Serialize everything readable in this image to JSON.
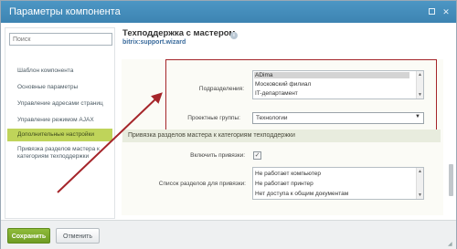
{
  "window": {
    "title": "Параметры компонента"
  },
  "sidebar": {
    "search_placeholder": "Поиск",
    "items": [
      {
        "label": "Шаблон компонента"
      },
      {
        "label": "Основные параметры"
      },
      {
        "label": "Управление адресами страниц"
      },
      {
        "label": "Управление режимом AJAX"
      },
      {
        "label": "Дополнительные настройки",
        "active": true
      },
      {
        "label_line1": "Привязка разделов мастера к",
        "label_line2": "категориям техподдержки"
      }
    ]
  },
  "component": {
    "title": "Техподдержка с мастером",
    "code": "bitrix:support.wizard"
  },
  "fields": {
    "departments": {
      "label": "Подразделения:",
      "options": [
        "ADima",
        "Московский филиал",
        "IT-департамент"
      ],
      "selected": "ADima"
    },
    "project_groups": {
      "label": "Проектные группы:",
      "value": "Технологии"
    },
    "section_title": "Привязка разделов мастера к категориям техподдержки",
    "enable_binding": {
      "label": "Включить привязки:",
      "checked": true
    },
    "binding_sections": {
      "label": "Список разделов для привязки:",
      "options": [
        "Не работает компьютер",
        "Не работает принтер",
        "Нет доступа к общим документам"
      ]
    }
  },
  "footer": {
    "save_label": "Сохранить",
    "cancel_label": "Отменить"
  },
  "colors": {
    "titlebar": "#3d84b2",
    "active_nav": "#bfd45a",
    "highlight_border": "#a5252a",
    "save_button": "#7aa82c"
  }
}
